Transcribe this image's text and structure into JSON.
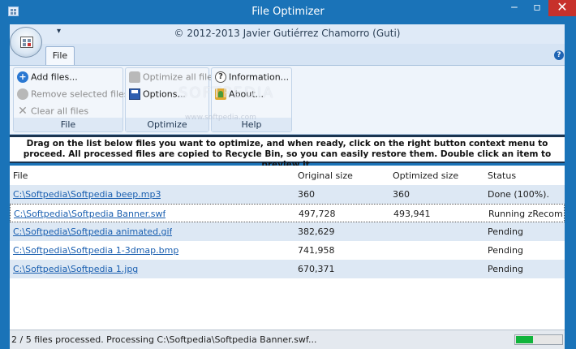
{
  "window": {
    "title": "File Optimizer",
    "subtitle": "© 2012-2013 Javier Gutiérrez Chamorro (Guti)",
    "minimize_glyph": "‒",
    "maximize_glyph": "▫",
    "close_glyph": "✕"
  },
  "ribbon": {
    "tabs": [
      {
        "label": "File",
        "active": true
      }
    ],
    "help_glyph": "?",
    "groups": [
      {
        "label": "File",
        "buttons": [
          {
            "label": "Add files...",
            "icon": "add-icon",
            "enabled": true
          },
          {
            "label": "Remove selected files",
            "icon": "remove-icon",
            "enabled": false
          },
          {
            "label": "Clear all files",
            "icon": "clear-icon",
            "enabled": false
          }
        ]
      },
      {
        "label": "Optimize",
        "buttons": [
          {
            "label": "Optimize all files",
            "icon": "optimize-icon",
            "enabled": false
          },
          {
            "label": "Options...",
            "icon": "options-icon",
            "enabled": true
          }
        ]
      },
      {
        "label": "Help",
        "buttons": [
          {
            "label": "Information...",
            "icon": "information-icon",
            "enabled": true
          },
          {
            "label": "About...",
            "icon": "about-icon",
            "enabled": true
          }
        ]
      }
    ]
  },
  "watermark": {
    "text": "SOFTPEDIA",
    "sub": "www.softpedia.com"
  },
  "instructions": "Drag on the list below files you want to optimize, and when ready, click on the right button context menu to proceed. All processed files are copied to Recycle Bin, so you can easily restore them. Double click an item to preview it.",
  "list": {
    "columns": [
      "File",
      "Original size",
      "Optimized size",
      "Status"
    ],
    "rows": [
      {
        "file": "C:\\Softpedia\\Softpedia beep.mp3",
        "original": "360",
        "optimized": "360",
        "status": "Done (100%)."
      },
      {
        "file": "C:\\Softpedia\\Softpedia Banner.swf",
        "original": "497,728",
        "optimized": "493,941",
        "status": "Running zRecompress..."
      },
      {
        "file": "C:\\Softpedia\\Softpedia animated.gif",
        "original": "382,629",
        "optimized": "",
        "status": "Pending"
      },
      {
        "file": "C:\\Softpedia\\Softpedia 1-3dmap.bmp",
        "original": "741,958",
        "optimized": "",
        "status": "Pending"
      },
      {
        "file": "C:\\Softpedia\\Softpedia 1.jpg",
        "original": "670,371",
        "optimized": "",
        "status": "Pending"
      }
    ],
    "selected_row": 1
  },
  "statusbar": {
    "text": "2 / 5 files processed. Processing C:\\Softpedia\\Softpedia Banner.swf...",
    "progress_percent": 40
  },
  "colors": {
    "accent": "#1a73b8",
    "close_button": "#c7312b",
    "link": "#1a5fb0",
    "progress": "#11b43c"
  }
}
